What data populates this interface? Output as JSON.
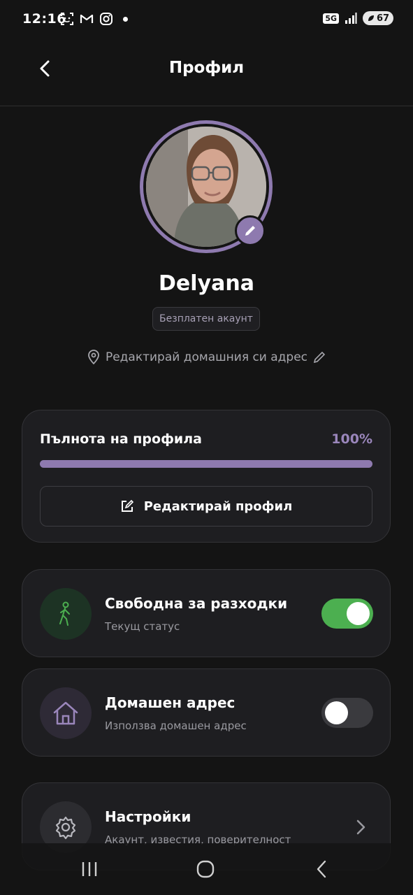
{
  "status_bar": {
    "time": "12:16",
    "network": "5G",
    "battery": "67",
    "icons_left": [
      "face-scan-icon",
      "gmail-icon",
      "instagram-icon",
      "notification-dot-icon"
    ],
    "icons_right": [
      "5g-icon",
      "signal-icon",
      "battery-icon"
    ]
  },
  "header": {
    "title": "Профил",
    "back_icon": "chevron-left-icon"
  },
  "profile": {
    "name": "Delyana",
    "account_type": "Безплатен акаунт",
    "address_link": "Редактирай домашния си адрес",
    "ring_color": "#8e7aaf"
  },
  "completeness": {
    "label": "Пълнота на профила",
    "value_text": "100%",
    "percent": 100,
    "edit_button": "Редактирай профил"
  },
  "rows": {
    "walk": {
      "title": "Свободна за разходки",
      "subtitle": "Текущ статус",
      "enabled": true,
      "icon": "walking-person-icon"
    },
    "home": {
      "title": "Домашен адрес",
      "subtitle": "Използва домашен адрес",
      "enabled": false,
      "icon": "home-icon"
    },
    "settings": {
      "title": "Настройки",
      "subtitle": "Акаунт, известия, поверителност",
      "icon": "gear-icon"
    }
  },
  "nav": {
    "recent_icon": "recent-apps-icon",
    "home_icon": "home-circle-icon",
    "back_icon": "back-icon"
  },
  "colors": {
    "accent": "#8e7aaf",
    "toggle_on": "#4caf50",
    "background": "#141414",
    "card": "#1e1e21"
  }
}
